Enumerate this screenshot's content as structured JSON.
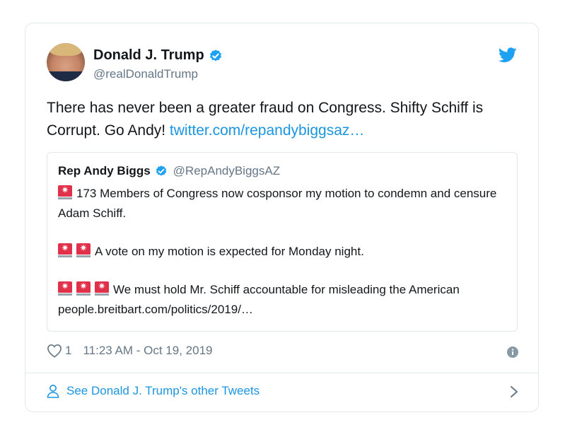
{
  "tweet": {
    "author_name": "Donald J. Trump",
    "author_handle": "@realDonaldTrump",
    "text": "There has never been a greater fraud on Congress. Shifty Schiff is Corrupt. Go Andy! ",
    "link": "twitter.com/repandybiggsaz…",
    "likes": "1",
    "timestamp": "11:23 AM - Oct 19, 2019"
  },
  "quote": {
    "author_name": "Rep Andy Biggs",
    "author_handle": "@RepAndyBiggsAZ",
    "para1": "173 Members of Congress now cosponsor my motion to condemn and censure Adam Schiff.",
    "para2": "A vote on my motion is expected for Monday night.",
    "para3": "We must hold Mr. Schiff accountable for misleading the American people.breitbart.com/politics/2019/…",
    "para1_emoji_count": 1,
    "para2_emoji_count": 2,
    "para3_emoji_count": 3
  },
  "footer": {
    "link_text": "See Donald J. Trump's other Tweets"
  },
  "icons": {
    "verified": "verified-badge-icon",
    "bird": "twitter-bird-icon",
    "heart": "heart-icon",
    "info": "info-icon",
    "person": "person-icon",
    "chevron": "chevron-right-icon",
    "siren": "police-light-emoji"
  },
  "colors": {
    "link_blue": "#1b95e0",
    "text": "#14171a",
    "secondary": "#657786",
    "border": "#e1e8ed",
    "siren_red": "#e0304a"
  }
}
